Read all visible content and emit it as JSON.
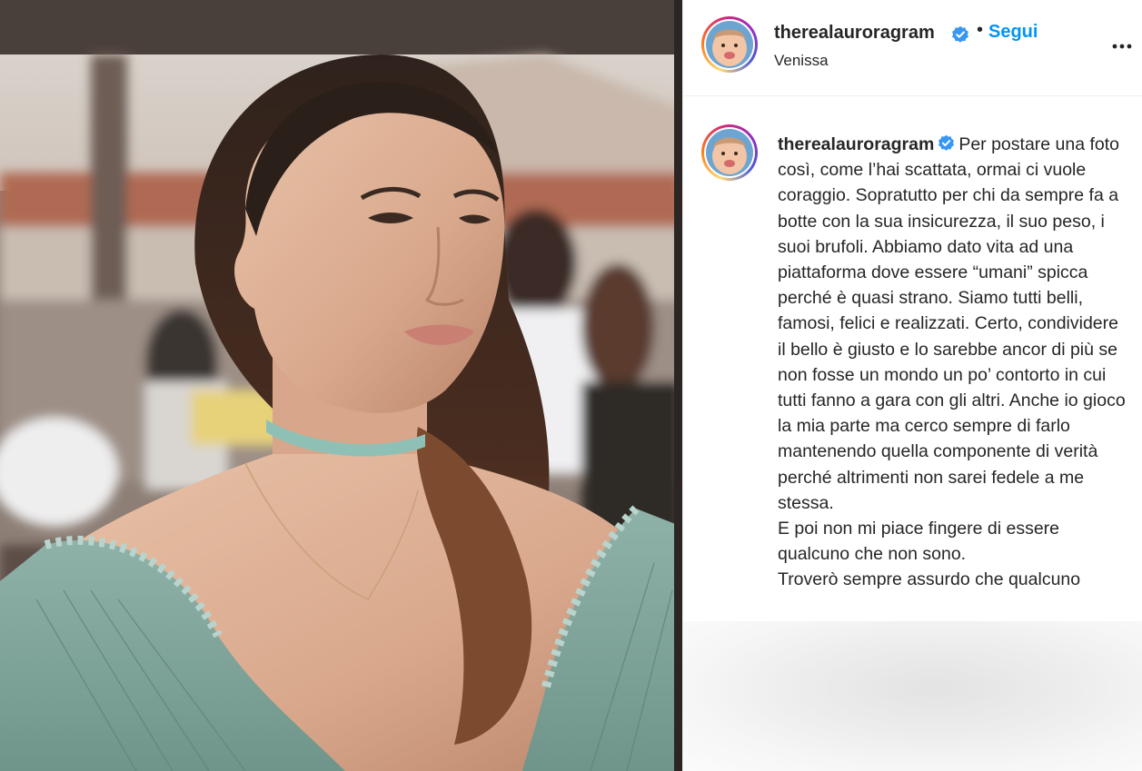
{
  "post": {
    "username": "therealauroragram",
    "verified": true,
    "follow_label": "Segui",
    "separator": "•",
    "location": "Venissa",
    "more_icon": "more-horizontal-icon",
    "caption": "Per postare una foto così, come l’hai scattata, ormai ci vuole coraggio. Sopratutto per chi da sempre fa a botte con la sua insicurezza, il suo peso, i suoi brufoli. Abbiamo dato vita ad una piattaforma dove essere “umani” spicca perché è quasi strano. Siamo tutti belli, famosi, felici e realizzati. Certo, condividere il bello è giusto e lo sarebbe ancor di più se non fosse un mondo un po’ contorto in cui tutti fanno a gara con gli altri. Anche io gioco la mia parte ma cerco sempre di farlo mantenendo quella componente di verità perché altrimenti non sarei fedele a me stessa.\nE poi non mi piace fingere di essere qualcuno che non sono.\nTroverò sempre assurdo che qualcuno"
  },
  "colors": {
    "follow_blue": "#0095f6",
    "verified_blue": "#3897f0",
    "text": "#262626",
    "divider": "#efefef"
  }
}
